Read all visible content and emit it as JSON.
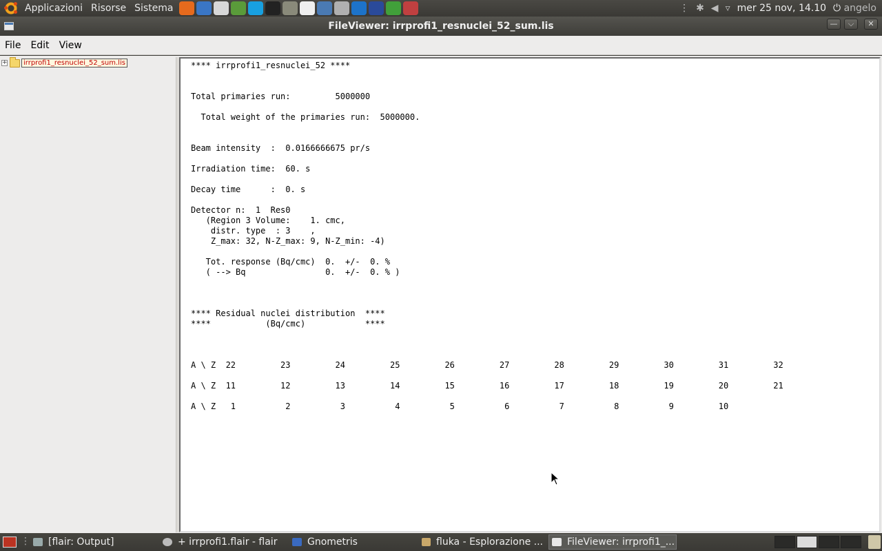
{
  "top_panel": {
    "menus": [
      "Applicazioni",
      "Risorse",
      "Sistema"
    ],
    "launchers": [
      {
        "name": "firefox-icon",
        "color": "#e66a1d"
      },
      {
        "name": "help-icon",
        "color": "#3a76c5"
      },
      {
        "name": "mail-icon",
        "color": "#d8d8d8"
      },
      {
        "name": "contacts-icon",
        "color": "#5a9b3a"
      },
      {
        "name": "skype-icon",
        "color": "#18a0e0"
      },
      {
        "name": "terminal-icon",
        "color": "#222222"
      },
      {
        "name": "pipette-icon",
        "color": "#8a8a7a"
      },
      {
        "name": "document-icon",
        "color": "#efefef"
      },
      {
        "name": "monitor-icon",
        "color": "#4a7ab3"
      },
      {
        "name": "gears-icon",
        "color": "#b0b0b0"
      },
      {
        "name": "matlab-icon",
        "color": "#1d73c9"
      },
      {
        "name": "globe-icon",
        "color": "#2a4a9a"
      },
      {
        "name": "qt-icon",
        "color": "#41a03a"
      },
      {
        "name": "tool-icon",
        "color": "#c04040"
      }
    ],
    "clock": "mer 25 nov, 14.10",
    "user": "angelo"
  },
  "window": {
    "title": "FileViewer: irrprofi1_resnuclei_52_sum.lis"
  },
  "menubar": {
    "items": [
      "File",
      "Edit",
      "View"
    ]
  },
  "tree": {
    "expander": "+",
    "file": "irrprofi1_resnuclei_52_sum.lis"
  },
  "file_content": "**** irrprofi1_resnuclei_52 ****\n\n\nTotal primaries run:         5000000\n\n  Total weight of the primaries run:  5000000.\n\n\nBeam intensity  :  0.0166666675 pr/s\n\nIrradiation time:  60. s\n\nDecay time      :  0. s\n\nDetector n:  1  Res0\n   (Region 3 Volume:    1. cmc,\n    distr. type  : 3    ,\n    Z_max: 32, N-Z_max: 9, N-Z_min: -4)\n\n   Tot. response (Bq/cmc)  0.  +/-  0. %\n   ( --> Bq                0.  +/-  0. % )\n\n\n\n**** Residual nuclei distribution  ****\n****           (Bq/cmc)            ****\n\n\n\nA \\ Z  22         23         24         25         26         27         28         29         30         31         32\n\nA \\ Z  11         12         13         14         15         16         17         18         19         20         21\n\nA \\ Z   1          2          3          4          5          6          7          8          9         10",
  "taskbar": {
    "tasks": [
      {
        "label": "[flair: Output]",
        "active": false
      },
      {
        "label": "+ irrprofi1.flair - flair",
        "active": false
      },
      {
        "label": "Gnometris",
        "active": false
      },
      {
        "label": "fluka - Esplorazione ...",
        "active": false
      },
      {
        "label": "FileViewer: irrprofi1_...",
        "active": true
      }
    ]
  }
}
